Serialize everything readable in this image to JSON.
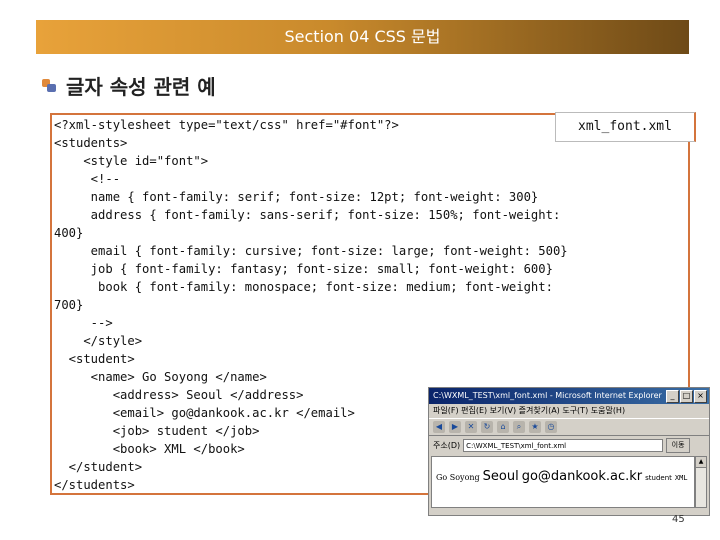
{
  "banner": {
    "title": "Section 04 CSS 문법"
  },
  "heading": {
    "text": "글자 속성 관련 예"
  },
  "filename": "xml_font.xml",
  "code_lines": [
    "<?xml-stylesheet type=\"text/css\" href=\"#font\"?>",
    "<students>",
    "    <style id=\"font\">",
    "     <!--",
    "     name { font-family: serif; font-size: 12pt; font-weight: 300}",
    "     address { font-family: sans-serif; font-size: 150%; font-weight:",
    "400}",
    "     email { font-family: cursive; font-size: large; font-weight: 500}",
    "     job { font-family: fantasy; font-size: small; font-weight: 600}",
    "      book { font-family: monospace; font-size: medium; font-weight:",
    "700}",
    "     -->",
    "    </style>",
    "  <student>",
    "     <name> Go Soyong </name>",
    "        <address> Seoul </address>",
    "        <email> go@dankook.ac.kr </email>",
    "        <job> student </job>",
    "        <book> XML </book>",
    "  </student>",
    "</students>"
  ],
  "browser": {
    "title": "C:\\WXML_TEST\\xml_font.xml - Microsoft Internet Explorer",
    "menu": "파일(F)  편집(E)  보기(V)  즐겨찾기(A)  도구(T)  도움말(H)",
    "address_label": "주소(D)",
    "address_value": "C:\\WXML_TEST\\xml_font.xml",
    "go_label": "이동",
    "rendered": {
      "name": "Go Soyong",
      "address": "Seoul",
      "email": "go@dankook.ac.kr",
      "job": "student",
      "book": "XML"
    }
  },
  "page_number": "45"
}
